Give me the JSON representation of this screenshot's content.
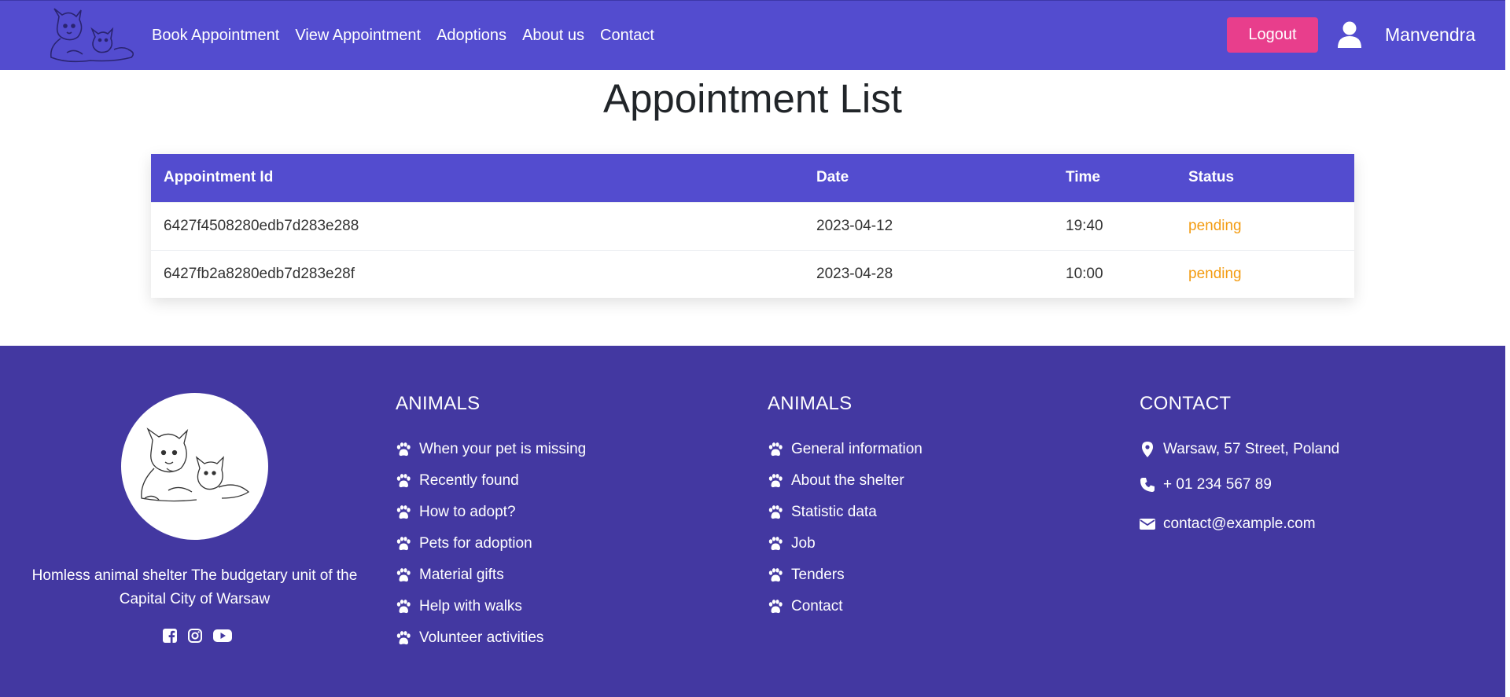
{
  "nav": {
    "items": [
      {
        "label": "Book Appointment"
      },
      {
        "label": "View Appointment"
      },
      {
        "label": "Adoptions"
      },
      {
        "label": "About us"
      },
      {
        "label": "Contact"
      }
    ],
    "logout_label": "Logout",
    "username": "Manvendra",
    "icons": {
      "user": "user-icon",
      "logo": "dog-cat-logo"
    }
  },
  "main": {
    "title": "Appointment List",
    "table": {
      "headers": [
        "Appointment Id",
        "Date",
        "Time",
        "Status"
      ],
      "rows": [
        {
          "id": "6427f4508280edb7d283e288",
          "date": "2023-04-12",
          "time": "19:40",
          "status": "pending"
        },
        {
          "id": "6427fb2a8280edb7d283e28f",
          "date": "2023-04-28",
          "time": "10:00",
          "status": "pending"
        }
      ]
    }
  },
  "footer": {
    "description": "Homless animal shelter The budgetary unit of the Capital City of Warsaw",
    "social_icons": [
      "facebook-icon",
      "instagram-icon",
      "youtube-icon"
    ],
    "col1": {
      "title": "ANIMALS",
      "items": [
        "When your pet is missing",
        "Recently found",
        "How to adopt?",
        "Pets for adoption",
        "Material gifts",
        "Help with walks",
        "Volunteer activities"
      ]
    },
    "col2": {
      "title": "ANIMALS",
      "items": [
        "General information",
        "About the shelter",
        "Statistic data",
        "Job",
        "Tenders",
        "Contact"
      ]
    },
    "contact": {
      "title": "CONTACT",
      "address": "Warsaw, 57 Street, Poland",
      "phone": "+ 01 234 567 89",
      "email": "contact@example.com"
    }
  },
  "colors": {
    "navbar": "#534ccf",
    "footer": "#4338a1",
    "logout": "#e83e8c",
    "status_pending": "#f39c12"
  }
}
